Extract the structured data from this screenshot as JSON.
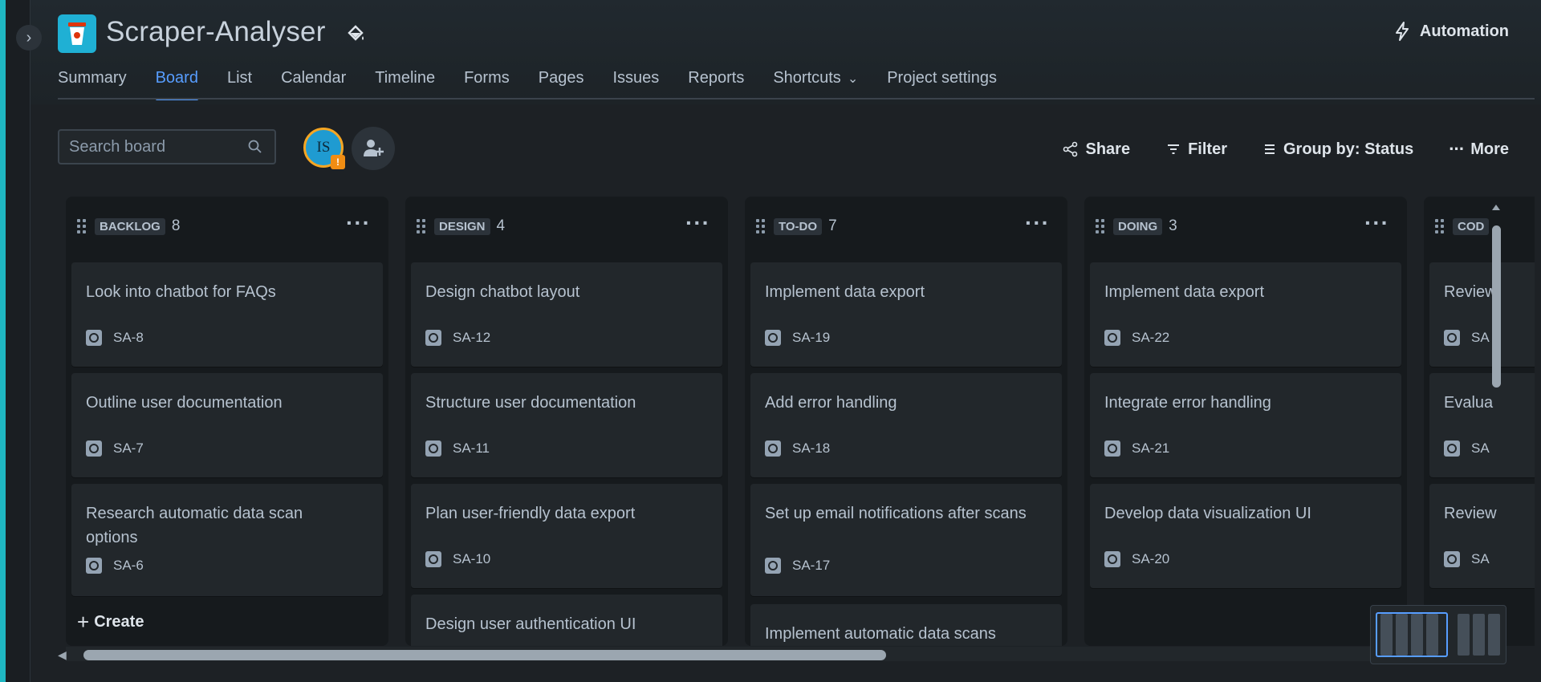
{
  "project": {
    "title": "Scraper-Analyser",
    "automation_label": "Automation"
  },
  "tabs": [
    {
      "label": "Summary",
      "active": false
    },
    {
      "label": "Board",
      "active": true
    },
    {
      "label": "List",
      "active": false
    },
    {
      "label": "Calendar",
      "active": false
    },
    {
      "label": "Timeline",
      "active": false
    },
    {
      "label": "Forms",
      "active": false
    },
    {
      "label": "Pages",
      "active": false
    },
    {
      "label": "Issues",
      "active": false
    },
    {
      "label": "Reports",
      "active": false
    },
    {
      "label": "Shortcuts",
      "active": false
    },
    {
      "label": "Project settings",
      "active": false
    }
  ],
  "search": {
    "placeholder": "Search board",
    "value": ""
  },
  "user": {
    "initials": "IS",
    "badge": "!"
  },
  "toolbar": {
    "share_label": "Share",
    "filter_label": "Filter",
    "group_label": "Group by: Status",
    "more_label": "More"
  },
  "columns": [
    {
      "name": "BACKLOG",
      "count": "8",
      "cards": [
        {
          "title": "Look into chatbot for FAQs",
          "key": "SA-8"
        },
        {
          "title": "Outline user documentation",
          "key": "SA-7"
        },
        {
          "title": "Research automatic data scan options",
          "key": "SA-6"
        }
      ],
      "create_label": "Create"
    },
    {
      "name": "DESIGN",
      "count": "4",
      "cards": [
        {
          "title": "Design chatbot layout",
          "key": "SA-12"
        },
        {
          "title": "Structure user documentation",
          "key": "SA-11"
        },
        {
          "title": "Plan user-friendly data export",
          "key": "SA-10"
        },
        {
          "title": "Design user authentication UI",
          "key": ""
        }
      ]
    },
    {
      "name": "TO-DO",
      "count": "7",
      "cards": [
        {
          "title": "Implement data export",
          "key": "SA-19"
        },
        {
          "title": "Add error handling",
          "key": "SA-18"
        },
        {
          "title": "Set up email notifications after scans",
          "key": "SA-17"
        },
        {
          "title": "Implement automatic data scans",
          "key": ""
        }
      ]
    },
    {
      "name": "DOING",
      "count": "3",
      "cards": [
        {
          "title": "Implement data export",
          "key": "SA-22"
        },
        {
          "title": "Integrate error handling",
          "key": "SA-21"
        },
        {
          "title": "Develop data visualization UI",
          "key": "SA-20"
        }
      ]
    },
    {
      "name": "COD",
      "count": "",
      "cards": [
        {
          "title": "Review",
          "key": "SA"
        },
        {
          "title": "Evalua",
          "key": "SA"
        },
        {
          "title": "Review",
          "key": "SA"
        }
      ]
    }
  ],
  "colors": {
    "accent": "#579dff",
    "background": "#1d2125",
    "card": "#22272b",
    "project_icon": "#1fb0d4"
  }
}
